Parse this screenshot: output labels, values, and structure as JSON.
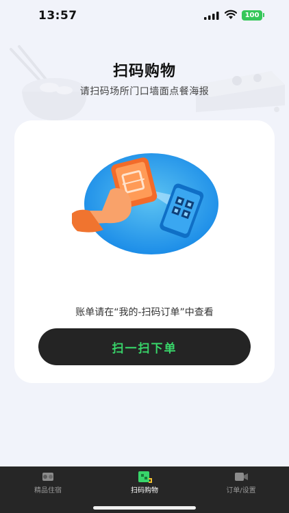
{
  "status_bar": {
    "time": "13:57",
    "battery": "100",
    "icons": [
      "signal-icon",
      "wifi-icon",
      "battery-icon"
    ],
    "battery_color": "#35c759"
  },
  "header": {
    "title": "扫码购物",
    "subtitle": "请扫码场所门口墙面点餐海报"
  },
  "card": {
    "hint": "账单请在“我的-扫码订单”中查看",
    "scan_button_label": "扫一扫下单"
  },
  "tab_bar": {
    "tabs": [
      {
        "label": "精品住宿",
        "icon": "hotel-icon",
        "active": false
      },
      {
        "label": "扫码购物",
        "icon": "scan-shop-icon",
        "active": true
      },
      {
        "label": "订单/设置",
        "icon": "order-settings-icon",
        "active": false
      }
    ]
  },
  "colors": {
    "accent_green": "#38d66a",
    "button_bg": "#242424",
    "page_bg": "#f1f3fa",
    "tab_bar_bg": "#262626"
  }
}
